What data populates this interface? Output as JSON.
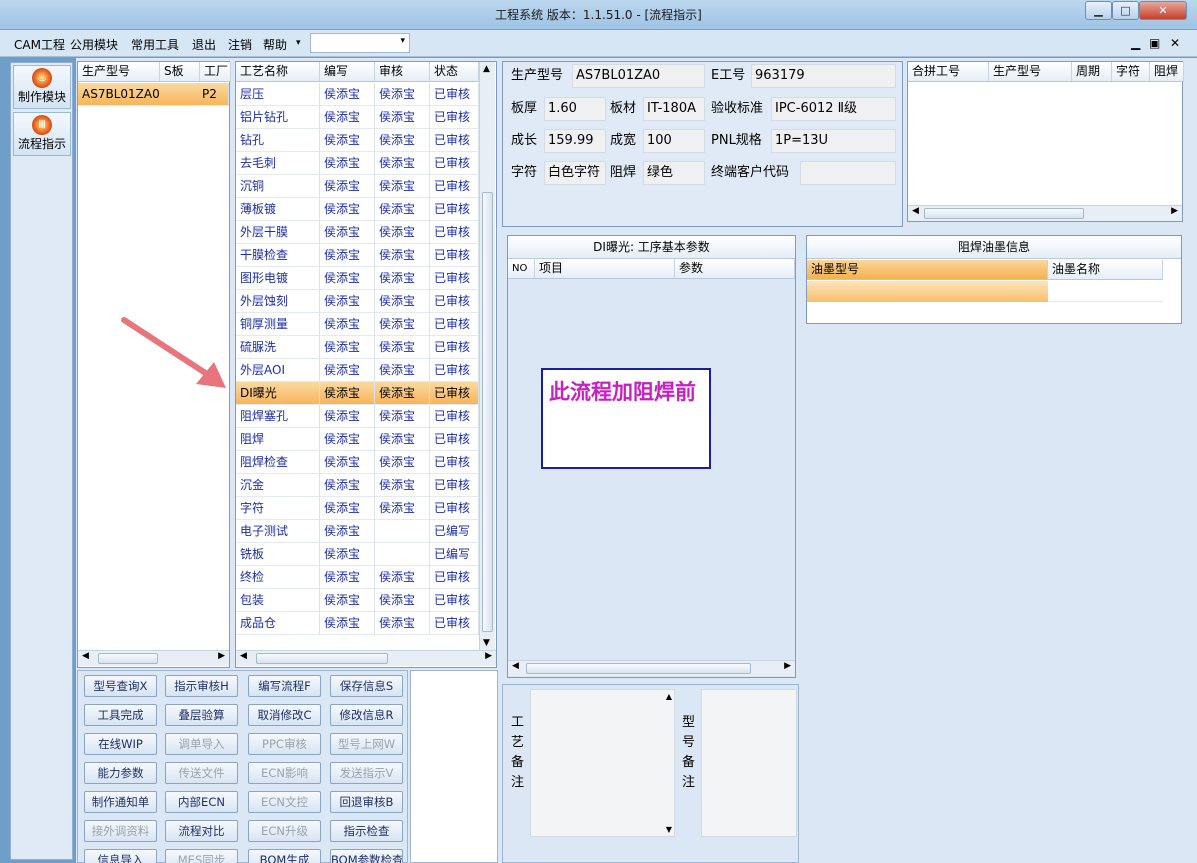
{
  "window": {
    "title": "工程系统   版本：1.1.51.0 - [流程指示]",
    "min": "▁",
    "max": "□",
    "close": "✕"
  },
  "menu": {
    "items": [
      "CAM工程",
      "公用模块",
      "常用工具",
      "退出",
      "注销",
      "帮助"
    ],
    "combo_arrow": "▾",
    "mdi": [
      "▁",
      "▣",
      "✕"
    ]
  },
  "nav": [
    {
      "label": "制作模块",
      "icon": "flame-icon"
    },
    {
      "label": "流程指示",
      "icon": "stop-icon"
    }
  ],
  "models": {
    "headers": [
      "生产型号",
      "S板",
      "工厂"
    ],
    "rows": [
      [
        "AS7BL01ZA0",
        "",
        "P2"
      ]
    ]
  },
  "process": {
    "headers": [
      "工艺名称",
      "编写",
      "审核",
      "状态"
    ],
    "selected_index": 13,
    "rows": [
      [
        "层压",
        "侯添宝",
        "侯添宝",
        "已审核"
      ],
      [
        "铝片钻孔",
        "侯添宝",
        "侯添宝",
        "已审核"
      ],
      [
        "钻孔",
        "侯添宝",
        "侯添宝",
        "已审核"
      ],
      [
        "去毛刺",
        "侯添宝",
        "侯添宝",
        "已审核"
      ],
      [
        "沉铜",
        "侯添宝",
        "侯添宝",
        "已审核"
      ],
      [
        "薄板镀",
        "侯添宝",
        "侯添宝",
        "已审核"
      ],
      [
        "外层干膜",
        "侯添宝",
        "侯添宝",
        "已审核"
      ],
      [
        "干膜检查",
        "侯添宝",
        "侯添宝",
        "已审核"
      ],
      [
        "图形电镀",
        "侯添宝",
        "侯添宝",
        "已审核"
      ],
      [
        "外层蚀刻",
        "侯添宝",
        "侯添宝",
        "已审核"
      ],
      [
        "铜厚测量",
        "侯添宝",
        "侯添宝",
        "已审核"
      ],
      [
        "硫脲洗",
        "侯添宝",
        "侯添宝",
        "已审核"
      ],
      [
        "外层AOI",
        "侯添宝",
        "侯添宝",
        "已审核"
      ],
      [
        "DI曝光",
        "侯添宝",
        "侯添宝",
        "已审核"
      ],
      [
        "阻焊塞孔",
        "侯添宝",
        "侯添宝",
        "已审核"
      ],
      [
        "阻焊",
        "侯添宝",
        "侯添宝",
        "已审核"
      ],
      [
        "阻焊检查",
        "侯添宝",
        "侯添宝",
        "已审核"
      ],
      [
        "沉金",
        "侯添宝",
        "侯添宝",
        "已审核"
      ],
      [
        "字符",
        "侯添宝",
        "侯添宝",
        "已审核"
      ],
      [
        "电子测试",
        "侯添宝",
        "",
        "已编写"
      ],
      [
        "铣板",
        "侯添宝",
        "",
        "已编写"
      ],
      [
        "终检",
        "侯添宝",
        "侯添宝",
        "已审核"
      ],
      [
        "包装",
        "侯添宝",
        "侯添宝",
        "已审核"
      ],
      [
        "成品仓",
        "侯添宝",
        "侯添宝",
        "已审核"
      ]
    ]
  },
  "info": {
    "prod_model_label": "生产型号",
    "prod_model": "AS7BL01ZA0",
    "e_no_label": "E工号",
    "e_no": "963179",
    "thickness_label": "板厚",
    "thickness": "1.60",
    "material_label": "板材",
    "material": "IT-180A",
    "standard_label": "验收标准",
    "standard": "IPC-6012 Ⅱ级",
    "length_label": "成长",
    "length": "159.99",
    "width_label": "成宽",
    "width": "100",
    "pnl_label": "PNL规格",
    "pnl": "1P=13U",
    "char_label": "字符",
    "char": "白色字符",
    "mask_label": "阻焊",
    "mask": "绿色",
    "customer_label": "终端客户代码",
    "customer": ""
  },
  "merge": {
    "headers": [
      "合拼工号",
      "生产型号",
      "周期",
      "字符",
      "阻焊"
    ]
  },
  "di": {
    "title": "DI曝光: 工序基本参数",
    "headers": [
      "NO",
      "项目",
      "参数"
    ],
    "note": "此流程加阻焊前"
  },
  "ink": {
    "title": "阻焊油墨信息",
    "headers": [
      "油墨型号",
      "油墨名称"
    ]
  },
  "remarks": {
    "process_label": "工艺备注",
    "model_label": "型号备注"
  },
  "buttons": [
    [
      {
        "t": "型号查询X",
        "d": false
      },
      {
        "t": "指示审核H",
        "d": false
      },
      {
        "t": "编写流程F",
        "d": false
      },
      {
        "t": "保存信息S",
        "d": false
      }
    ],
    [
      {
        "t": "工具完成",
        "d": false
      },
      {
        "t": "叠层验算",
        "d": false
      },
      {
        "t": "取消修改C",
        "d": false
      },
      {
        "t": "修改信息R",
        "d": false
      }
    ],
    [
      {
        "t": "在线WIP",
        "d": false
      },
      {
        "t": "调单导入",
        "d": true
      },
      {
        "t": "PPC审核",
        "d": true
      },
      {
        "t": "型号上网W",
        "d": true
      }
    ],
    [
      {
        "t": "能力参数",
        "d": false
      },
      {
        "t": "传送文件",
        "d": true
      },
      {
        "t": "ECN影响",
        "d": true
      },
      {
        "t": "发送指示V",
        "d": true
      }
    ],
    [
      {
        "t": "制作通知单",
        "d": false
      },
      {
        "t": "内部ECN",
        "d": false
      },
      {
        "t": "ECN文控",
        "d": true
      },
      {
        "t": "回退审核B",
        "d": false
      }
    ],
    [
      {
        "t": "接外调资料",
        "d": true
      },
      {
        "t": "流程对比",
        "d": false
      },
      {
        "t": "ECN升级",
        "d": true
      },
      {
        "t": "指示检查",
        "d": false
      }
    ],
    [
      {
        "t": "信息导入",
        "d": false
      },
      {
        "t": "MES同步",
        "d": true
      },
      {
        "t": "BOM生成",
        "d": false
      },
      {
        "t": "BOM参数检查",
        "d": false
      }
    ]
  ],
  "colors": {
    "selected_row": "#f7b55a",
    "accent": "#1b2ea8",
    "note_text": "#c81fc1",
    "note_border": "#1c1ca8",
    "arrow": "#e8757c"
  }
}
